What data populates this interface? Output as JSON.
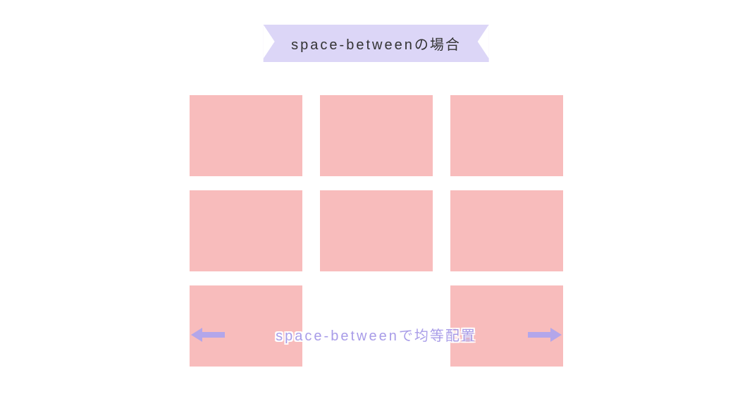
{
  "ribbon": {
    "code": "space-between",
    "suffix": "の場合"
  },
  "annotation": {
    "code": "space-between",
    "suffix": "で均等配置"
  },
  "colors": {
    "ribbonBg": "#dcd6f7",
    "boxBg": "#f8bcbc",
    "arrow": "#b3a6ea",
    "annotationText": "#a89ce8"
  }
}
